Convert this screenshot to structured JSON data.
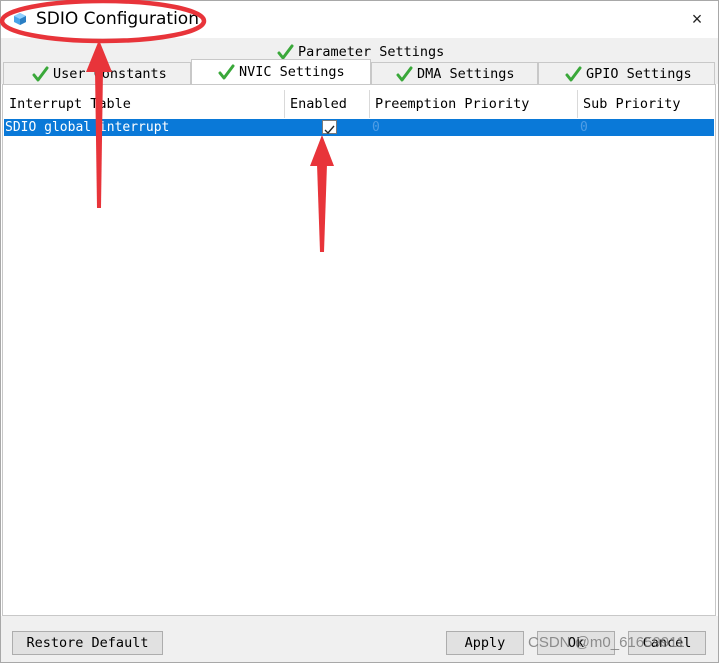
{
  "window": {
    "title": "SDIO Configuration",
    "close_icon": "×"
  },
  "tabs": {
    "top_row": [
      {
        "label": "Parameter Settings",
        "checked": true
      }
    ],
    "bottom_row": [
      {
        "label": "User Constants",
        "checked": true
      },
      {
        "label": "NVIC Settings",
        "checked": true,
        "selected": true
      },
      {
        "label": "DMA Settings",
        "checked": true
      },
      {
        "label": "GPIO Settings",
        "checked": true
      }
    ]
  },
  "table": {
    "columns": [
      "Interrupt Table",
      "Enabled",
      "Preemption Priority",
      "Sub Priority"
    ],
    "rows": [
      {
        "interrupt": "SDIO global interrupt",
        "enabled": true,
        "preemption": "0",
        "sub": "0"
      }
    ]
  },
  "buttons": {
    "restore_default": "Restore Default",
    "apply": "Apply",
    "ok": "Ok",
    "cancel": "Cancel"
  },
  "watermark": "CSDN @m0_61659911",
  "colors": {
    "selection": "#0a79d8",
    "check_green": "#3aa83a",
    "annotation_red": "#e8343a"
  }
}
